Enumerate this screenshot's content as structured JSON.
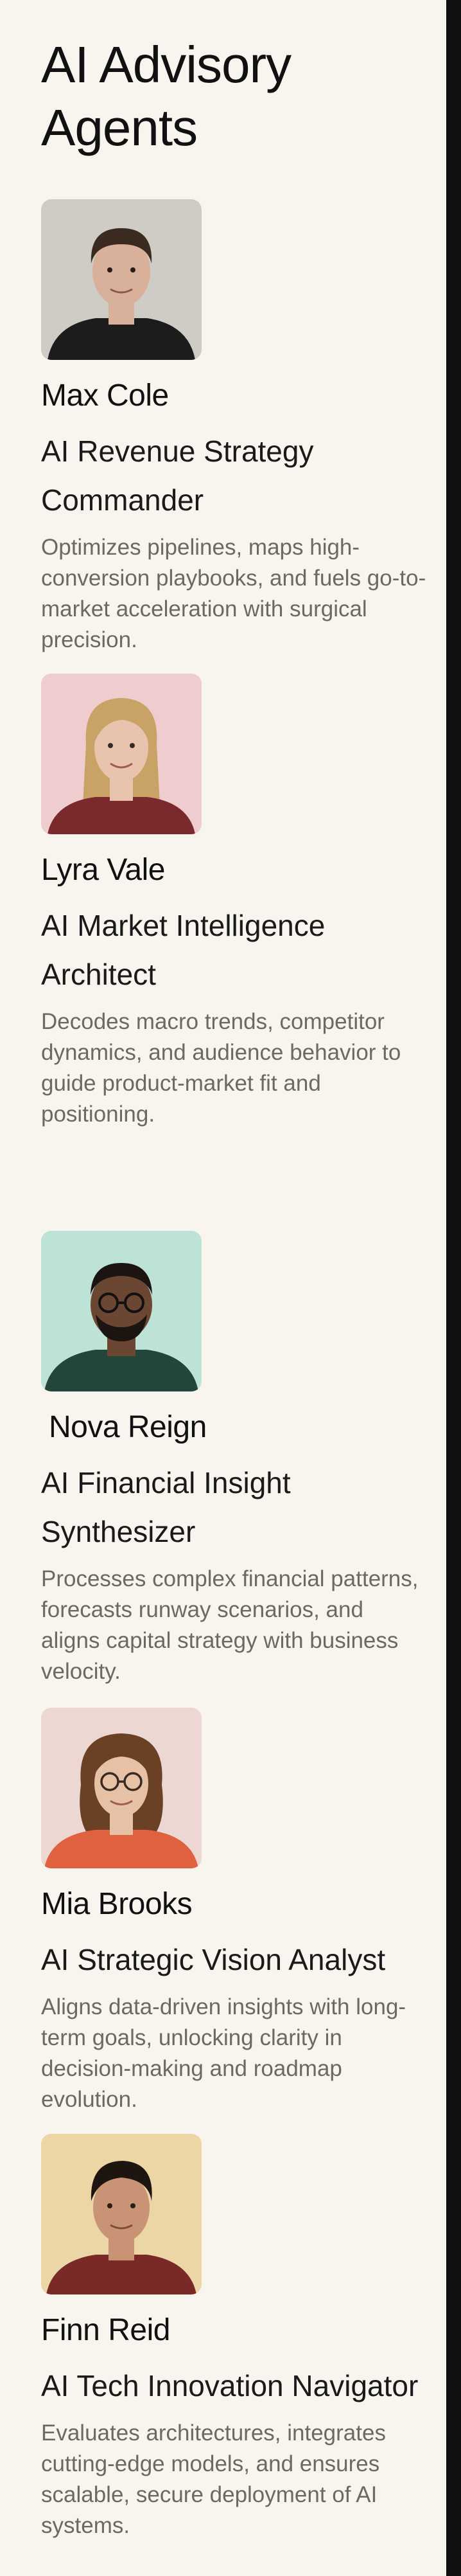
{
  "heading": "AI Advisory Agents",
  "agents": [
    {
      "name": "Max Cole",
      "role": "AI Revenue Strategy Commander",
      "description": "Optimizes pipelines, maps high-conversion playbooks, and fuels go-to-market acceleration with surgical precision.",
      "photo_bg": "#cfccc5",
      "shirt": "#1c1c1c",
      "hair": "#3a2a20",
      "skin": "#d9b09a"
    },
    {
      "name": "Lyra Vale",
      "role": "AI Market Intelligence Architect",
      "description": "Decodes macro trends, competitor dynamics, and audience behavior to guide product-market fit and positioning.",
      "photo_bg": "#efcccd",
      "shirt": "#7a2a2c",
      "hair": "#c9a366",
      "skin": "#e8c3ad"
    },
    {
      "name": "Nova Reign",
      "role": "AI Financial Insight Synthesizer",
      "description": "Processes complex financial patterns, forecasts runway scenarios, and aligns capital strategy with business velocity.",
      "photo_bg": "#bde3d6",
      "shirt": "#24463a",
      "hair": "#1b1410",
      "skin": "#6b4632"
    },
    {
      "name": "Mia Brooks",
      "role": "AI Strategic Vision Analyst",
      "description": "Aligns data-driven insights with long-term goals, unlocking clarity in decision-making and roadmap evolution.",
      "photo_bg": "#ecd7d3",
      "shirt": "#e0613d",
      "hair": "#6b4126",
      "skin": "#e7c1a6"
    },
    {
      "name": "Finn Reid",
      "role": "AI Tech Innovation Navigator",
      "description": "Evaluates architectures, integrates cutting-edge models, and ensures scalable, secure deployment of AI systems.",
      "photo_bg": "#ecd6a6",
      "shirt": "#7a2a26",
      "hair": "#1e1410",
      "skin": "#c99476"
    }
  ]
}
